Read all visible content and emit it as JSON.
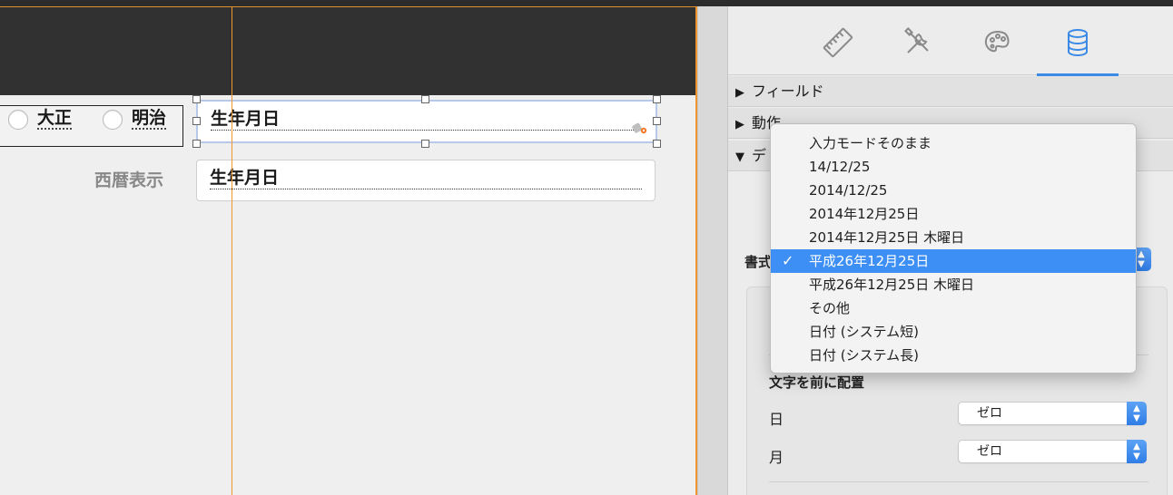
{
  "canvas": {
    "radio_options": [
      {
        "label": "大正"
      },
      {
        "label": "明治"
      }
    ],
    "field_selected": {
      "value": "生年月日"
    },
    "field_second": {
      "label": "西暦表示",
      "value": "生年月日"
    }
  },
  "inspector": {
    "tabs": [
      {
        "icon": "ruler-icon"
      },
      {
        "icon": "tools-icon"
      },
      {
        "icon": "palette-icon"
      },
      {
        "icon": "database-icon",
        "active": true
      }
    ],
    "sections": [
      {
        "label": "フィールド",
        "expanded": false
      },
      {
        "label": "動作",
        "expanded": false
      },
      {
        "label": "デ",
        "expanded": true
      }
    ],
    "format_label": "書式",
    "group": {
      "title": "文字を前に配置",
      "rows": [
        {
          "label": "日",
          "value": "ゼロ"
        },
        {
          "label": "月",
          "value": "ゼロ"
        }
      ]
    }
  },
  "dropdown": {
    "items": [
      {
        "label": "入力モードそのまま"
      },
      {
        "label": "14/12/25"
      },
      {
        "label": "2014/12/25"
      },
      {
        "label": "2014年12月25日"
      },
      {
        "label": "2014年12月25日 木曜日"
      },
      {
        "label": "平成26年12月25日",
        "selected": true
      },
      {
        "label": "平成26年12月25日 木曜日"
      },
      {
        "label": "その他"
      },
      {
        "label": "日付 (システム短)"
      },
      {
        "label": "日付 (システム長)"
      }
    ],
    "checkmark": "✓"
  },
  "colors": {
    "accent": "#3d8ff5",
    "guide": "#f0962e",
    "header": "#313131"
  }
}
